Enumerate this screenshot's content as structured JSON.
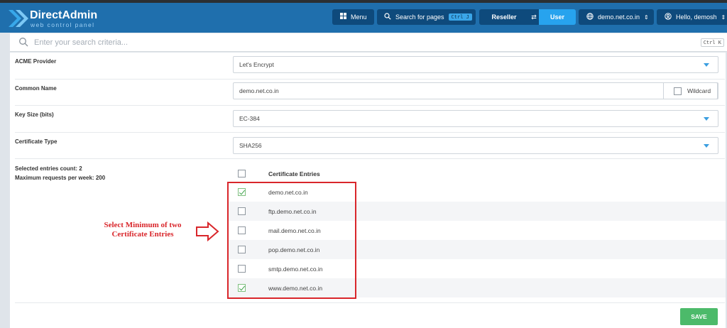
{
  "header": {
    "logo_title": "DirectAdmin",
    "logo_subtitle": "web control panel",
    "menu_label": "Menu",
    "search_pages_label": "Search for pages",
    "search_pages_shortcut": "Ctrl J",
    "role_reseller": "Reseller",
    "role_user": "User",
    "domain_select": "demo.net.co.in",
    "user_greeting": "Hello, demosh"
  },
  "search": {
    "placeholder": "Enter your search criteria...",
    "shortcut": "Ctrl K"
  },
  "form": {
    "acme_provider": {
      "label": "ACME Provider",
      "value": "Let's Encrypt"
    },
    "common_name": {
      "label": "Common Name",
      "value": "demo.net.co.in",
      "wildcard_label": "Wildcard",
      "wildcard_checked": false
    },
    "key_size": {
      "label": "Key Size (bits)",
      "value": "EC-384"
    },
    "certificate_type": {
      "label": "Certificate Type",
      "value": "SHA256"
    },
    "entries_info": {
      "selected_count": "Selected entries count: 2",
      "max_requests": "Maximum requests per week: 200"
    },
    "entries_header": "Certificate Entries",
    "entries": [
      {
        "domain": "demo.net.co.in",
        "checked": true
      },
      {
        "domain": "ftp.demo.net.co.in",
        "checked": false
      },
      {
        "domain": "mail.demo.net.co.in",
        "checked": false
      },
      {
        "domain": "pop.demo.net.co.in",
        "checked": false
      },
      {
        "domain": "smtp.demo.net.co.in",
        "checked": false
      },
      {
        "domain": "www.demo.net.co.in",
        "checked": true
      }
    ],
    "save_label": "SAVE"
  },
  "annotation": {
    "line1": "Select Minimum of two",
    "line2": "Certificate Entries"
  },
  "colors": {
    "header": "#1f6fad",
    "accent": "#3aa6e8",
    "save": "#4cba6a",
    "annotation": "#d9262b"
  }
}
